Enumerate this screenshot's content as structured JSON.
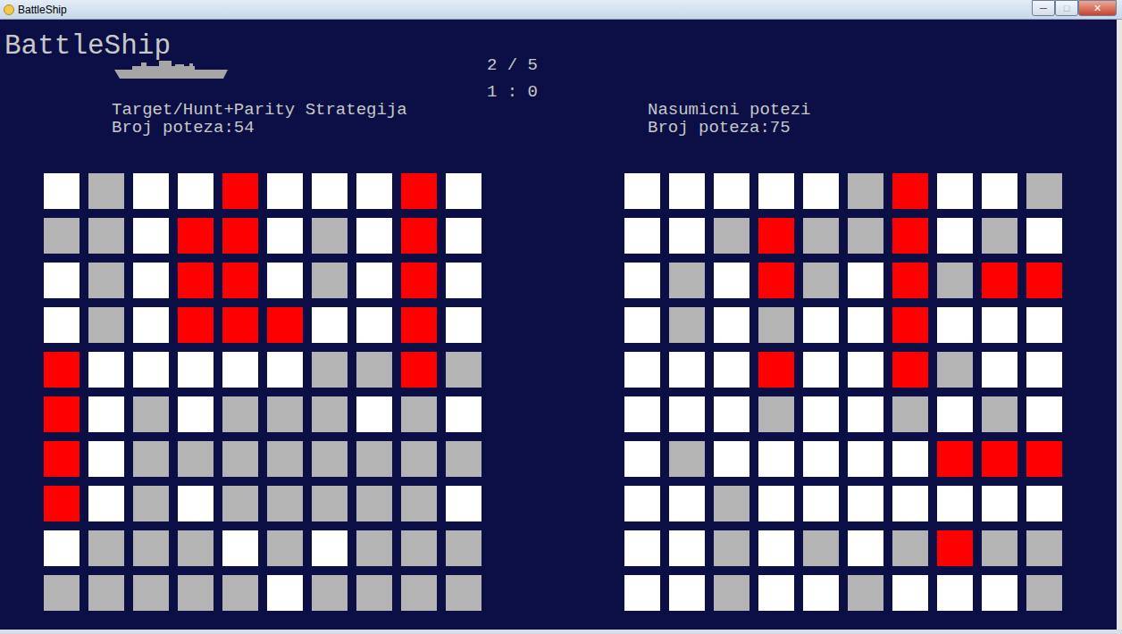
{
  "window": {
    "title": "BattleShip",
    "controls": [
      {
        "name": "minimize",
        "glyph": "─"
      },
      {
        "name": "maximize",
        "glyph": "□"
      },
      {
        "name": "close",
        "glyph": "✕"
      }
    ]
  },
  "logo": {
    "title": "BattleShip"
  },
  "match": {
    "round": "2 / 5",
    "score": "1 : 0"
  },
  "players": [
    {
      "name": "Target/Hunt+Parity Strategija",
      "moves_label": "Broj poteza:54",
      "grid": [
        [
          "open",
          "miss",
          "open",
          "open",
          "hit",
          "open",
          "open",
          "open",
          "hit",
          "open"
        ],
        [
          "miss",
          "miss",
          "open",
          "hit",
          "hit",
          "open",
          "miss",
          "open",
          "hit",
          "open"
        ],
        [
          "open",
          "miss",
          "open",
          "hit",
          "hit",
          "open",
          "miss",
          "open",
          "hit",
          "open"
        ],
        [
          "open",
          "miss",
          "open",
          "hit",
          "hit",
          "hit",
          "open",
          "open",
          "hit",
          "open"
        ],
        [
          "hit",
          "open",
          "open",
          "open",
          "open",
          "open",
          "miss",
          "miss",
          "hit",
          "miss"
        ],
        [
          "hit",
          "open",
          "miss",
          "open",
          "miss",
          "miss",
          "miss",
          "open",
          "miss",
          "open"
        ],
        [
          "hit",
          "open",
          "miss",
          "miss",
          "miss",
          "miss",
          "miss",
          "miss",
          "miss",
          "miss"
        ],
        [
          "hit",
          "open",
          "miss",
          "open",
          "miss",
          "miss",
          "miss",
          "miss",
          "miss",
          "open"
        ],
        [
          "open",
          "miss",
          "miss",
          "miss",
          "open",
          "miss",
          "open",
          "miss",
          "miss",
          "miss"
        ],
        [
          "miss",
          "miss",
          "miss",
          "miss",
          "miss",
          "open",
          "miss",
          "miss",
          "miss",
          "miss"
        ]
      ]
    },
    {
      "name": "Nasumicni potezi",
      "moves_label": "Broj poteza:75",
      "grid": [
        [
          "open",
          "open",
          "open",
          "open",
          "open",
          "miss",
          "hit",
          "open",
          "open",
          "miss"
        ],
        [
          "open",
          "open",
          "miss",
          "hit",
          "miss",
          "miss",
          "hit",
          "open",
          "miss",
          "open"
        ],
        [
          "open",
          "miss",
          "open",
          "hit",
          "miss",
          "open",
          "hit",
          "miss",
          "hit",
          "hit"
        ],
        [
          "open",
          "miss",
          "open",
          "miss",
          "open",
          "open",
          "hit",
          "open",
          "open",
          "open"
        ],
        [
          "open",
          "open",
          "open",
          "hit",
          "open",
          "open",
          "hit",
          "miss",
          "open",
          "open"
        ],
        [
          "open",
          "open",
          "open",
          "miss",
          "open",
          "open",
          "miss",
          "open",
          "miss",
          "open"
        ],
        [
          "open",
          "miss",
          "open",
          "open",
          "open",
          "open",
          "open",
          "hit",
          "hit",
          "hit"
        ],
        [
          "open",
          "open",
          "miss",
          "open",
          "open",
          "open",
          "open",
          "open",
          "open",
          "open"
        ],
        [
          "open",
          "open",
          "miss",
          "open",
          "miss",
          "open",
          "miss",
          "hit",
          "miss",
          "miss"
        ],
        [
          "open",
          "open",
          "miss",
          "open",
          "open",
          "miss",
          "open",
          "open",
          "open",
          "miss"
        ]
      ]
    }
  ]
}
